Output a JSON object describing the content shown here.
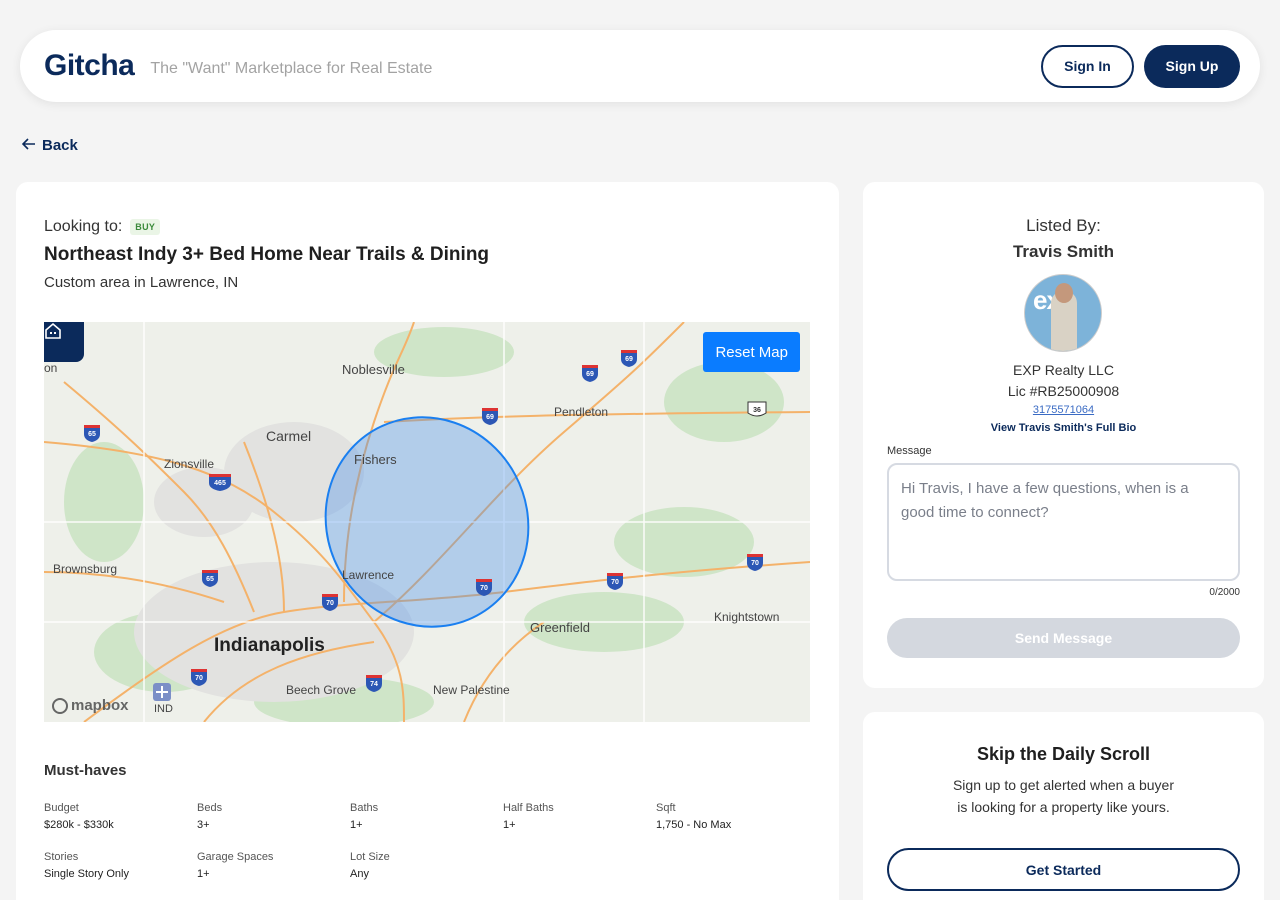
{
  "header": {
    "logo": "Gitcha",
    "tagline": "The \"Want\" Marketplace for Real Estate",
    "sign_in": "Sign In",
    "sign_up": "Sign Up"
  },
  "nav": {
    "back": "Back"
  },
  "listing": {
    "looking_label": "Looking to:",
    "badge": "BUY",
    "title": "Northeast Indy 3+ Bed Home Near Trails & Dining",
    "subtitle": "Custom area in Lawrence, IN"
  },
  "map": {
    "reset_label": "Reset Map",
    "attribution": "mapbox",
    "places": [
      {
        "label": "Noblesville",
        "big": false
      },
      {
        "label": "Pendleton",
        "big": false
      },
      {
        "label": "Carmel",
        "big": false
      },
      {
        "label": "Fishers",
        "big": false
      },
      {
        "label": "Zionsville",
        "big": false
      },
      {
        "label": "Brownsburg",
        "big": false
      },
      {
        "label": "Lawrence",
        "big": false
      },
      {
        "label": "Greenfield",
        "big": false
      },
      {
        "label": "Knightstown",
        "big": false
      },
      {
        "label": "Indianapolis",
        "big": true
      },
      {
        "label": "Beech Grove",
        "big": false
      },
      {
        "label": "New Palestine",
        "big": false
      },
      {
        "label": "IND",
        "big": false
      },
      {
        "label": "on",
        "big": false
      }
    ],
    "shields": [
      "69",
      "69",
      "69",
      "65",
      "465",
      "65",
      "70",
      "70",
      "70",
      "70",
      "70",
      "74"
    ],
    "us_shield": "36"
  },
  "must_haves": {
    "title": "Must-haves",
    "items": [
      {
        "label": "Budget",
        "value": "$280k - $330k"
      },
      {
        "label": "Beds",
        "value": "3+"
      },
      {
        "label": "Baths",
        "value": "1+"
      },
      {
        "label": "Half Baths",
        "value": "1+"
      },
      {
        "label": "Sqft",
        "value": "1,750 - No Max"
      },
      {
        "label": "Stories",
        "value": "Single Story Only"
      },
      {
        "label": "Garage Spaces",
        "value": "1+"
      },
      {
        "label": "Lot Size",
        "value": "Any"
      }
    ]
  },
  "agent": {
    "listed_by": "Listed By:",
    "name": "Travis Smith",
    "avatar_text": "exp",
    "company": "EXP Realty LLC",
    "license": "Lic #RB25000908",
    "phone": "3175571064",
    "bio_link": "View Travis Smith's Full Bio",
    "message_label": "Message",
    "message_value": "Hi Travis, I have a few questions, when is a good time to connect?",
    "counter": "0/2000",
    "send": "Send Message"
  },
  "scroll": {
    "title": "Skip the Daily Scroll",
    "line1": "Sign up to get alerted when a buyer",
    "line2": "is looking for a property like yours.",
    "button": "Get Started"
  }
}
